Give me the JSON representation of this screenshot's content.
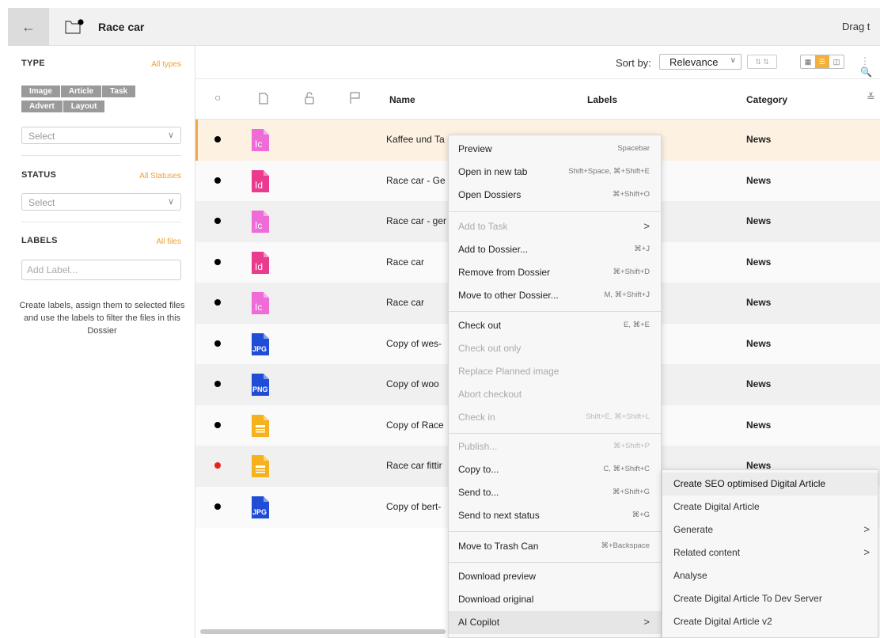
{
  "header": {
    "back_icon": "arrow-left-icon",
    "title": "Race car",
    "drag_text": "Drag t"
  },
  "sidebar": {
    "type": {
      "title": "TYPE",
      "link": "All types",
      "chips": [
        "Image",
        "Article",
        "Task",
        "Advert",
        "Layout"
      ],
      "select_placeholder": "Select"
    },
    "status": {
      "title": "STATUS",
      "link": "All Statuses",
      "select_placeholder": "Select"
    },
    "labels": {
      "title": "LABELS",
      "link": "All files",
      "input_placeholder": "Add Label...",
      "help_text": "Create labels, assign them to selected files and use the labels to filter the files in this Dossier"
    }
  },
  "toolbar": {
    "sort_label": "Sort by:",
    "sort_value": "Relevance"
  },
  "table": {
    "columns": {
      "name": "Name",
      "labels": "Labels",
      "category": "Category"
    },
    "rows": [
      {
        "name": "Kaffee und Ta",
        "category": "News",
        "icon": "incopy-icon",
        "dot_color": "#000000"
      },
      {
        "name": "Race car - Ge",
        "category": "News",
        "icon": "indesign-icon",
        "dot_color": "#000000"
      },
      {
        "name": "Race car - ger",
        "category": "News",
        "icon": "incopy-icon",
        "dot_color": "#000000"
      },
      {
        "name": "Race car",
        "category": "News",
        "icon": "indesign-icon",
        "dot_color": "#000000"
      },
      {
        "name": "Race car",
        "category": "News",
        "icon": "incopy-icon",
        "dot_color": "#000000"
      },
      {
        "name": "Copy of wes-",
        "category": "News",
        "icon": "jpg-icon",
        "dot_color": "#000000"
      },
      {
        "name": "Copy of woo",
        "category": "News",
        "icon": "png-icon",
        "dot_color": "#000000"
      },
      {
        "name": "Copy of Race",
        "category": "News",
        "icon": "article-icon",
        "dot_color": "#000000"
      },
      {
        "name": "Race car fittir",
        "category": "News",
        "icon": "article-icon",
        "dot_color": "#e8231a"
      },
      {
        "name": "Copy of bert-",
        "category": "",
        "icon": "jpg-icon",
        "dot_color": "#000000"
      }
    ]
  },
  "context_menu": {
    "items": [
      {
        "label": "Preview",
        "shortcut": "Spacebar"
      },
      {
        "label": "Open in new tab",
        "shortcut": "Shift+Space, ⌘+Shift+E"
      },
      {
        "label": "Open Dossiers",
        "shortcut": "⌘+Shift+O"
      },
      {
        "label": "Add to Task",
        "shortcut": ">"
      },
      {
        "label": "Add to Dossier...",
        "shortcut": "⌘+J"
      },
      {
        "label": "Remove from Dossier",
        "shortcut": "⌘+Shift+D"
      },
      {
        "label": "Move to other Dossier...",
        "shortcut": "M, ⌘+Shift+J"
      },
      {
        "label": "Check out",
        "shortcut": "E, ⌘+E"
      },
      {
        "label": "Check out only",
        "shortcut": ""
      },
      {
        "label": "Replace Planned image",
        "shortcut": ""
      },
      {
        "label": "Abort checkout",
        "shortcut": ""
      },
      {
        "label": "Check in",
        "shortcut": "Shift+E, ⌘+Shift+L"
      },
      {
        "label": "Publish...",
        "shortcut": "⌘+Shift+P"
      },
      {
        "label": "Copy to...",
        "shortcut": "C, ⌘+Shift+C"
      },
      {
        "label": "Send to...",
        "shortcut": "⌘+Shift+G"
      },
      {
        "label": "Send to next status",
        "shortcut": "⌘+G"
      },
      {
        "label": "Move to Trash Can",
        "shortcut": "⌘+Backspace"
      },
      {
        "label": "Download preview",
        "shortcut": ""
      },
      {
        "label": "Download original",
        "shortcut": ""
      },
      {
        "label": "AI Copilot",
        "shortcut": ">"
      }
    ]
  },
  "submenu": {
    "items": [
      {
        "label": "Create SEO optimised Digital Article",
        "arrow": ""
      },
      {
        "label": "Create Digital Article",
        "arrow": ""
      },
      {
        "label": "Generate",
        "arrow": ">"
      },
      {
        "label": "Related content",
        "arrow": ">"
      },
      {
        "label": "Analyse",
        "arrow": ""
      },
      {
        "label": "Create Digital Article To Dev Server",
        "arrow": ""
      },
      {
        "label": "Create Digital Article v2",
        "arrow": ""
      }
    ]
  },
  "colors": {
    "accent": "#f2a84a",
    "incopy": "#ef6bd8",
    "indesign": "#ea3b8f",
    "jpg": "#1f4dd6",
    "article": "#f5b21c"
  }
}
